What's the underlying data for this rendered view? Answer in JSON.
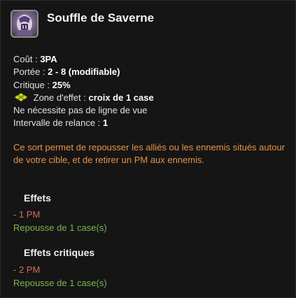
{
  "spell": {
    "name": "Souffle de Saverne",
    "icon": "spell-portrait-icon"
  },
  "stats": {
    "cost_label": "Coût :",
    "cost_value": "3PA",
    "range_label": "Portée :",
    "range_value": "2 - 8 (modifiable)",
    "crit_label": "Critique :",
    "crit_value": "25%",
    "zone_icon": "cross-zone-icon",
    "zone_label": "Zone d'effet :",
    "zone_value": "croix de 1 case",
    "los_text": "Ne nécessite pas de ligne de vue",
    "cooldown_label": "Intervalle de relance :",
    "cooldown_value": "1"
  },
  "description": "Ce sort permet de repousser les alliés ou les ennemis situés autour de votre cible, et de retirer un PM aux ennemis.",
  "effects": {
    "title": "Effets",
    "items": [
      "- 1 PM",
      "Repousse de 1 case(s)"
    ]
  },
  "critical_effects": {
    "title": "Effets critiques",
    "items": [
      "- 2 PM",
      "Repousse de 1 case(s)"
    ]
  },
  "colors": {
    "description": "#e79344",
    "negative": "#d66b5b",
    "positive": "#77b84e",
    "zone_icon": "#c9d21e"
  }
}
